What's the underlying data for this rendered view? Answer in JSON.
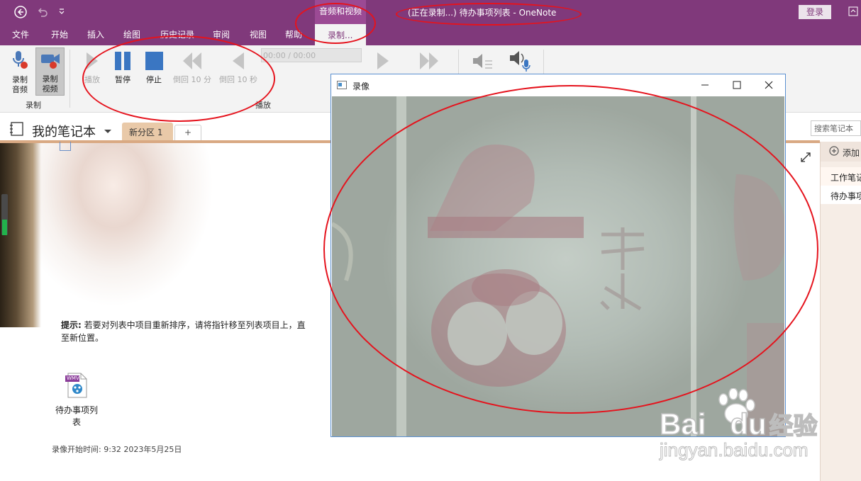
{
  "titlebar": {
    "window_title": "(正在录制...) 待办事项列表  -  OneNote",
    "context_group": "音频和视频",
    "login_label": "登录"
  },
  "menu": {
    "tabs": [
      "文件",
      "开始",
      "插入",
      "绘图",
      "历史记录",
      "审阅",
      "视图",
      "帮助"
    ],
    "context_tab": "录制..."
  },
  "ribbon": {
    "record_audio": [
      "录制",
      "音频"
    ],
    "record_video": [
      "录制",
      "视频"
    ],
    "record_group": "录制",
    "play": "播放",
    "pause": "暂停",
    "stop": "停止",
    "rewind10m": "倒回 10 分",
    "rewind10s": "倒回 10 秒",
    "time": "00:00 / 00:00",
    "playback_group": "播放"
  },
  "notebook": {
    "name": "我的笔记本",
    "section": "新分区 1",
    "add_tab": "+",
    "search_placeholder": "搜索笔记本"
  },
  "right_pane": {
    "add_label": "添加",
    "notebook_label": "工作笔记",
    "page_label": "待办事项"
  },
  "page": {
    "tip_bold": "提示:",
    "tip_text": " 若要对列表中项目重新排序，请将指针移至列表项目上，直",
    "tip_text2": "至新位置。",
    "file_badge": "WMV",
    "file_name": [
      "待办事项列",
      "表"
    ],
    "record_time": "录像开始时间: 9:32 2023年5月25日"
  },
  "video_window": {
    "title": "录像"
  },
  "watermark": {
    "line1_a": "Bai",
    "line1_b": "du",
    "line1_c": "经验",
    "line2": "jingyan.baidu.com"
  },
  "colors": {
    "onenote_purple": "#80397b",
    "annotation_red": "#e5131d",
    "section_tab": "#e9c9a8"
  }
}
